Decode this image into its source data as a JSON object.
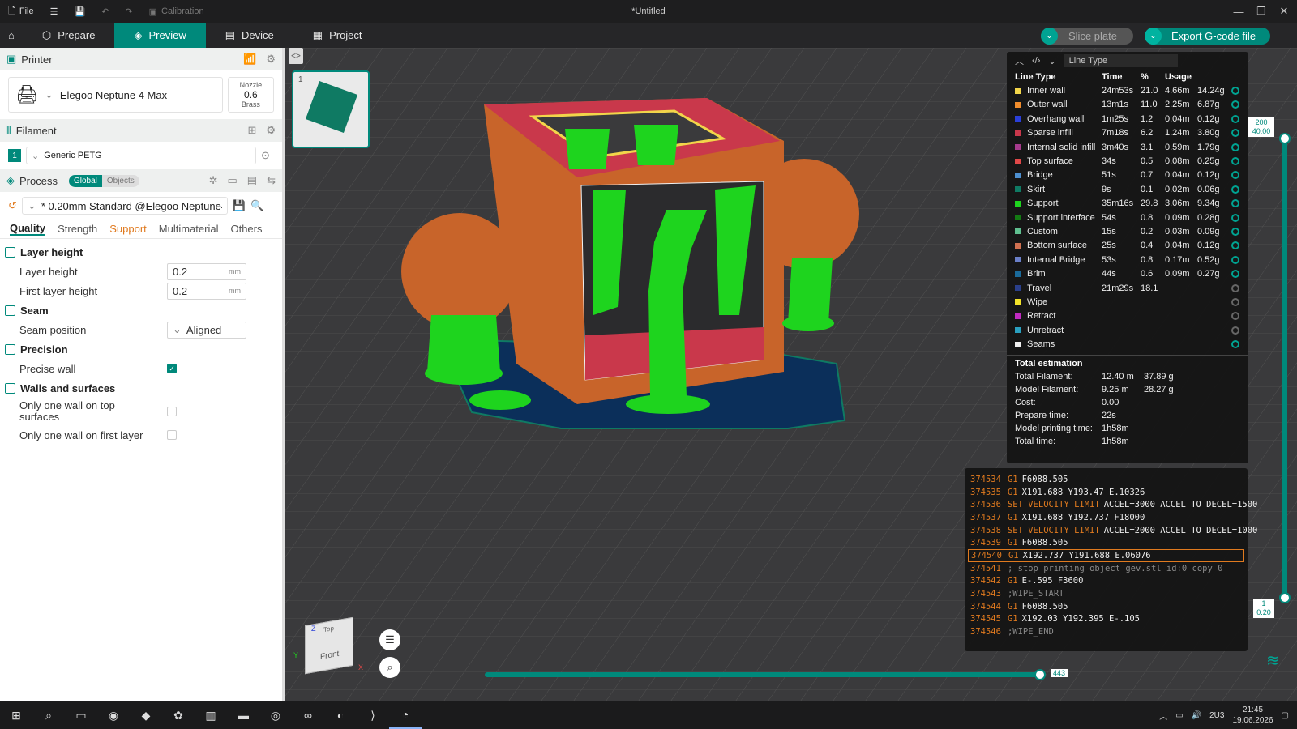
{
  "titlebar": {
    "file_label": "File",
    "calibration_label": "Calibration",
    "window_title": "*Untitled"
  },
  "tabs": [
    {
      "label": "Prepare"
    },
    {
      "label": "Preview"
    },
    {
      "label": "Device"
    },
    {
      "label": "Project"
    }
  ],
  "actions": {
    "slice_label": "Slice plate",
    "export_label": "Export G-code file"
  },
  "printer": {
    "section": "Printer",
    "name": "Elegoo Neptune 4 Max",
    "nozzle_label": "Nozzle",
    "nozzle_value": "0.6",
    "nozzle_material": "Brass"
  },
  "filament": {
    "section": "Filament",
    "index": "1",
    "name": "Generic PETG"
  },
  "process": {
    "section": "Process",
    "toggle_global": "Global",
    "toggle_objects": "Objects",
    "profile": "* 0.20mm Standard @Elegoo Neptune4...",
    "subtabs": [
      "Quality",
      "Strength",
      "Support",
      "Multimaterial",
      "Others"
    ]
  },
  "settings": {
    "layer_height_group": "Layer height",
    "layer_height_label": "Layer height",
    "layer_height_value": "0.2",
    "first_layer_label": "First layer height",
    "first_layer_value": "0.2",
    "unit": "mm",
    "seam_group": "Seam",
    "seam_position_label": "Seam position",
    "seam_position_value": "Aligned",
    "precision_group": "Precision",
    "precise_wall_label": "Precise wall",
    "walls_group": "Walls and surfaces",
    "one_wall_top_label": "Only one wall on top surfaces",
    "one_wall_first_label": "Only one wall on first layer"
  },
  "viewport": {
    "plate_number": "1",
    "cube_top": "Top",
    "cube_front": "Front",
    "axis_z": "Z",
    "axis_y": "Y",
    "axis_x": "X",
    "layer_top_a": "200",
    "layer_top_b": "40.00",
    "layer_bottom_a": "1",
    "layer_bottom_b": "0.20",
    "move_slider_value": "443"
  },
  "legend": {
    "title": "Line Type",
    "headers": [
      "Line Type",
      "Time",
      "%",
      "Usage"
    ],
    "rows": [
      {
        "name": "Inner wall",
        "time": "24m53s",
        "pct": "21.0",
        "len": "4.66m",
        "g": "14.24g",
        "color": "#f2d54a"
      },
      {
        "name": "Outer wall",
        "time": "13m1s",
        "pct": "11.0",
        "len": "2.25m",
        "g": "6.87g",
        "color": "#f08c2c"
      },
      {
        "name": "Overhang wall",
        "time": "1m25s",
        "pct": "1.2",
        "len": "0.04m",
        "g": "0.12g",
        "color": "#2a3fd8"
      },
      {
        "name": "Sparse infill",
        "time": "7m18s",
        "pct": "6.2",
        "len": "1.24m",
        "g": "3.80g",
        "color": "#c9384b"
      },
      {
        "name": "Internal solid infill",
        "time": "3m40s",
        "pct": "3.1",
        "len": "0.59m",
        "g": "1.79g",
        "color": "#a63a8c"
      },
      {
        "name": "Top surface",
        "time": "34s",
        "pct": "0.5",
        "len": "0.08m",
        "g": "0.25g",
        "color": "#e04848"
      },
      {
        "name": "Bridge",
        "time": "51s",
        "pct": "0.7",
        "len": "0.04m",
        "g": "0.12g",
        "color": "#4d8fcf"
      },
      {
        "name": "Skirt",
        "time": "9s",
        "pct": "0.1",
        "len": "0.02m",
        "g": "0.06g",
        "color": "#0f7a63"
      },
      {
        "name": "Support",
        "time": "35m16s",
        "pct": "29.8",
        "len": "3.06m",
        "g": "9.34g",
        "color": "#1ed41e"
      },
      {
        "name": "Support interface",
        "time": "54s",
        "pct": "0.8",
        "len": "0.09m",
        "g": "0.28g",
        "color": "#137a13"
      },
      {
        "name": "Custom",
        "time": "15s",
        "pct": "0.2",
        "len": "0.03m",
        "g": "0.09g",
        "color": "#5fbf8f"
      },
      {
        "name": "Bottom surface",
        "time": "25s",
        "pct": "0.4",
        "len": "0.04m",
        "g": "0.12g",
        "color": "#d07050"
      },
      {
        "name": "Internal Bridge",
        "time": "53s",
        "pct": "0.8",
        "len": "0.17m",
        "g": "0.52g",
        "color": "#6a7fc8"
      },
      {
        "name": "Brim",
        "time": "44s",
        "pct": "0.6",
        "len": "0.09m",
        "g": "0.27g",
        "color": "#1a6a9a"
      },
      {
        "name": "Travel",
        "time": "21m29s",
        "pct": "18.1",
        "len": "",
        "g": "",
        "color": "#2a3f8a",
        "hidden": true
      },
      {
        "name": "Wipe",
        "time": "",
        "pct": "",
        "len": "",
        "g": "",
        "color": "#f2e22a",
        "hidden": true
      },
      {
        "name": "Retract",
        "time": "",
        "pct": "",
        "len": "",
        "g": "",
        "color": "#c02ac0",
        "hidden": true
      },
      {
        "name": "Unretract",
        "time": "",
        "pct": "",
        "len": "",
        "g": "",
        "color": "#2aa0c0",
        "hidden": true
      },
      {
        "name": "Seams",
        "time": "",
        "pct": "",
        "len": "",
        "g": "",
        "color": "#f0f0f0"
      }
    ],
    "estimation_title": "Total estimation",
    "estimation": [
      {
        "k": "Total Filament:",
        "v": "12.40 m    37.89 g"
      },
      {
        "k": "Model Filament:",
        "v": "9.25 m      28.27 g"
      },
      {
        "k": "Cost:",
        "v": "0.00"
      },
      {
        "k": "Prepare time:",
        "v": "22s"
      },
      {
        "k": "Model printing time:",
        "v": "1h58m"
      },
      {
        "k": "Total time:",
        "v": "1h58m"
      }
    ]
  },
  "gcode": [
    {
      "n": "374534",
      "cmd": "G1",
      "rest": "F6088.505"
    },
    {
      "n": "374535",
      "cmd": "G1",
      "rest": "X191.688 Y193.47 E.10326"
    },
    {
      "n": "374536",
      "cmd": "SET_VELOCITY_LIMIT",
      "rest": "ACCEL=3000 ACCEL_TO_DECEL=1500"
    },
    {
      "n": "374537",
      "cmd": "G1",
      "rest": "X191.688 Y192.737 F18000"
    },
    {
      "n": "374538",
      "cmd": "SET_VELOCITY_LIMIT",
      "rest": "ACCEL=2000 ACCEL_TO_DECEL=1000"
    },
    {
      "n": "374539",
      "cmd": "G1",
      "rest": "F6088.505"
    },
    {
      "n": "374540",
      "cmd": "G1",
      "rest": "X192.737 Y191.688 E.06076",
      "current": true
    },
    {
      "n": "374541",
      "cmd": "",
      "rest": "; stop printing object gev.stl id:0 copy 0",
      "comment": true
    },
    {
      "n": "374542",
      "cmd": "G1",
      "rest": "E-.595 F3600"
    },
    {
      "n": "374543",
      "cmd": "",
      "rest": ";WIPE_START",
      "comment": true
    },
    {
      "n": "374544",
      "cmd": "G1",
      "rest": "F6088.505"
    },
    {
      "n": "374545",
      "cmd": "G1",
      "rest": "X192.03 Y192.395 E-.105"
    },
    {
      "n": "374546",
      "cmd": "",
      "rest": ";WIPE_END",
      "comment": true
    }
  ],
  "taskbar": {
    "lang": "2U3",
    "time": "21:45",
    "date": "19.06.2026"
  },
  "colors": {
    "accent": "#00897b",
    "model_orange": "#c8642a",
    "support_green": "#1ed41e",
    "infill_red": "#c9384b"
  }
}
